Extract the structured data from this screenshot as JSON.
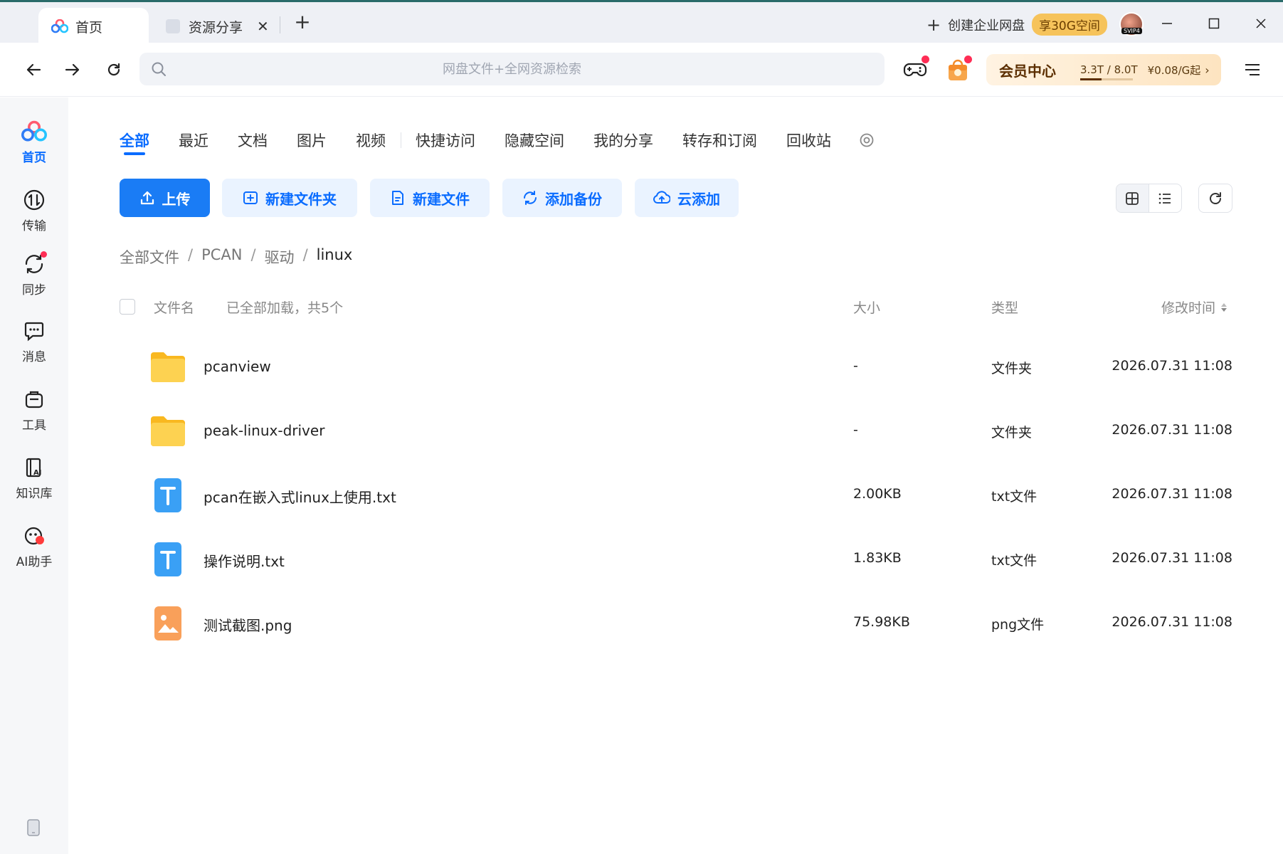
{
  "tabs": [
    {
      "label": "首页",
      "active": true
    },
    {
      "label": "资源分享",
      "active": false
    }
  ],
  "titlebar": {
    "enterprise_label": "创建企业网盘",
    "promo_label": "享30G空间",
    "avatar_tag": "SVIP4"
  },
  "toolbar": {
    "search_placeholder": "网盘文件+全网资源检索",
    "vip_title": "会员中心",
    "vip_quota": "3.3T / 8.0T",
    "vip_price": "¥0.08/G起",
    "vip_usage_fraction": 0.41
  },
  "sidebar": {
    "items": [
      {
        "label": "首页",
        "icon": "cloud-logo-icon",
        "active": true
      },
      {
        "label": "传输",
        "icon": "transfer-icon",
        "active": false
      },
      {
        "label": "同步",
        "icon": "sync-icon",
        "active": false,
        "badge": true
      },
      {
        "label": "消息",
        "icon": "message-icon",
        "active": false
      },
      {
        "label": "工具",
        "icon": "toolbox-icon",
        "active": false
      },
      {
        "label": "知识库",
        "icon": "knowledge-base-icon",
        "active": false
      },
      {
        "label": "AI助手",
        "icon": "ai-assistant-icon",
        "active": false
      }
    ]
  },
  "nav_tabs": [
    "全部",
    "最近",
    "文档",
    "图片",
    "视频",
    "快捷访问",
    "隐藏空间",
    "我的分享",
    "转存和订阅",
    "回收站"
  ],
  "actions": {
    "upload": "上传",
    "new_folder": "新建文件夹",
    "new_file": "新建文件",
    "add_backup": "添加备份",
    "cloud_add": "云添加"
  },
  "breadcrumb": [
    "全部文件",
    "PCAN",
    "驱动",
    "linux"
  ],
  "table": {
    "col_name": "文件名",
    "loaded_status": "已全部加载，共5个",
    "col_size": "大小",
    "col_type": "类型",
    "col_time": "修改时间",
    "rows": [
      {
        "name": "pcanview",
        "size": "-",
        "type": "文件夹",
        "time": "2026.07.31 11:08",
        "icon": "folder-icon"
      },
      {
        "name": "peak-linux-driver",
        "size": "-",
        "type": "文件夹",
        "time": "2026.07.31 11:08",
        "icon": "folder-icon"
      },
      {
        "name": "pcan在嵌入式linux上使用.txt",
        "size": "2.00KB",
        "type": "txt文件",
        "time": "2026.07.31 11:08",
        "icon": "txt-file-icon"
      },
      {
        "name": "操作说明.txt",
        "size": "1.83KB",
        "type": "txt文件",
        "time": "2026.07.31 11:08",
        "icon": "txt-file-icon"
      },
      {
        "name": "测试截图.png",
        "size": "75.98KB",
        "type": "png文件",
        "time": "2026.07.31 11:08",
        "icon": "image-file-icon"
      }
    ]
  },
  "colors": {
    "accent": "#0a6cff",
    "primary_button": "#1a7cf5",
    "folder": "#fbc531",
    "txt_icon": "#3aa0f5",
    "img_icon": "#f9a05a",
    "badge": "#ff2d55"
  }
}
